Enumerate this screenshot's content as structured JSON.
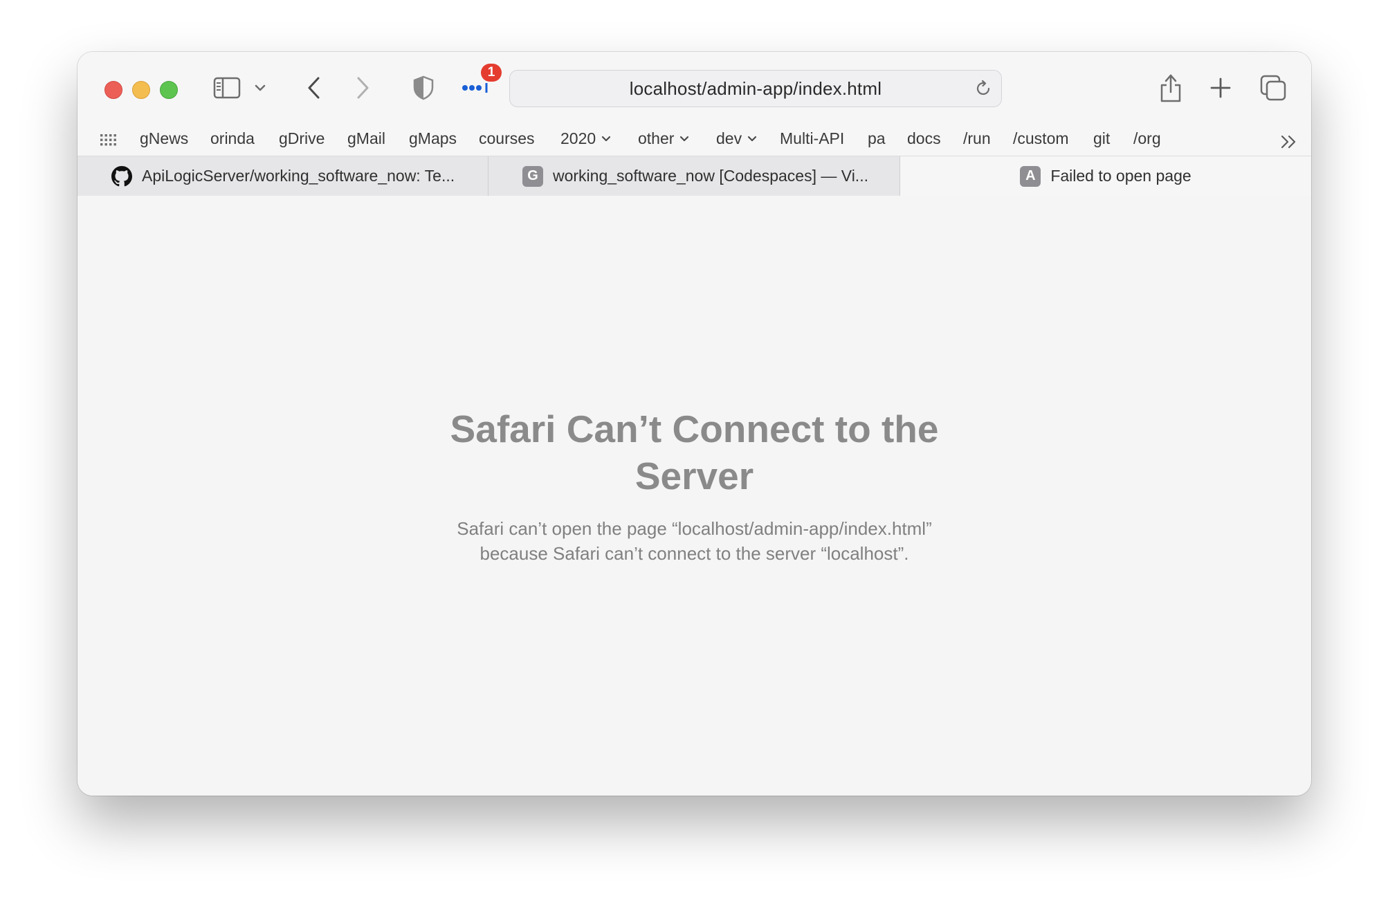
{
  "browser": {
    "url": "localhost/admin-app/index.html",
    "extension_badge_count": "1"
  },
  "bookmarks": [
    {
      "label": "gNews",
      "folder": false
    },
    {
      "label": "orinda",
      "folder": false
    },
    {
      "label": "gDrive",
      "folder": false
    },
    {
      "label": "gMail",
      "folder": false
    },
    {
      "label": "gMaps",
      "folder": false
    },
    {
      "label": "courses",
      "folder": false
    },
    {
      "label": "2020",
      "folder": true
    },
    {
      "label": "other",
      "folder": true
    },
    {
      "label": "dev",
      "folder": true
    },
    {
      "label": "Multi-API",
      "folder": false
    },
    {
      "label": "pa",
      "folder": false
    },
    {
      "label": "docs",
      "folder": false
    },
    {
      "label": "/run",
      "folder": false
    },
    {
      "label": "/custom",
      "folder": false
    },
    {
      "label": "git",
      "folder": false
    },
    {
      "label": "/org",
      "folder": false
    }
  ],
  "tabs": [
    {
      "title": "ApiLogicServer/working_software_now: Te...",
      "favicon": "github-icon"
    },
    {
      "title": "working_software_now [Codespaces] — Vi...",
      "favicon_letter": "G"
    },
    {
      "title": "Failed to open page",
      "favicon_letter": "A",
      "active": true
    }
  ],
  "error": {
    "title_line1": "Safari Can’t Connect to the",
    "title_line2": "Server",
    "message_line1": "Safari can’t open the page “localhost/admin-app/index.html”",
    "message_line2": "because Safari can’t connect to the server “localhost”."
  }
}
